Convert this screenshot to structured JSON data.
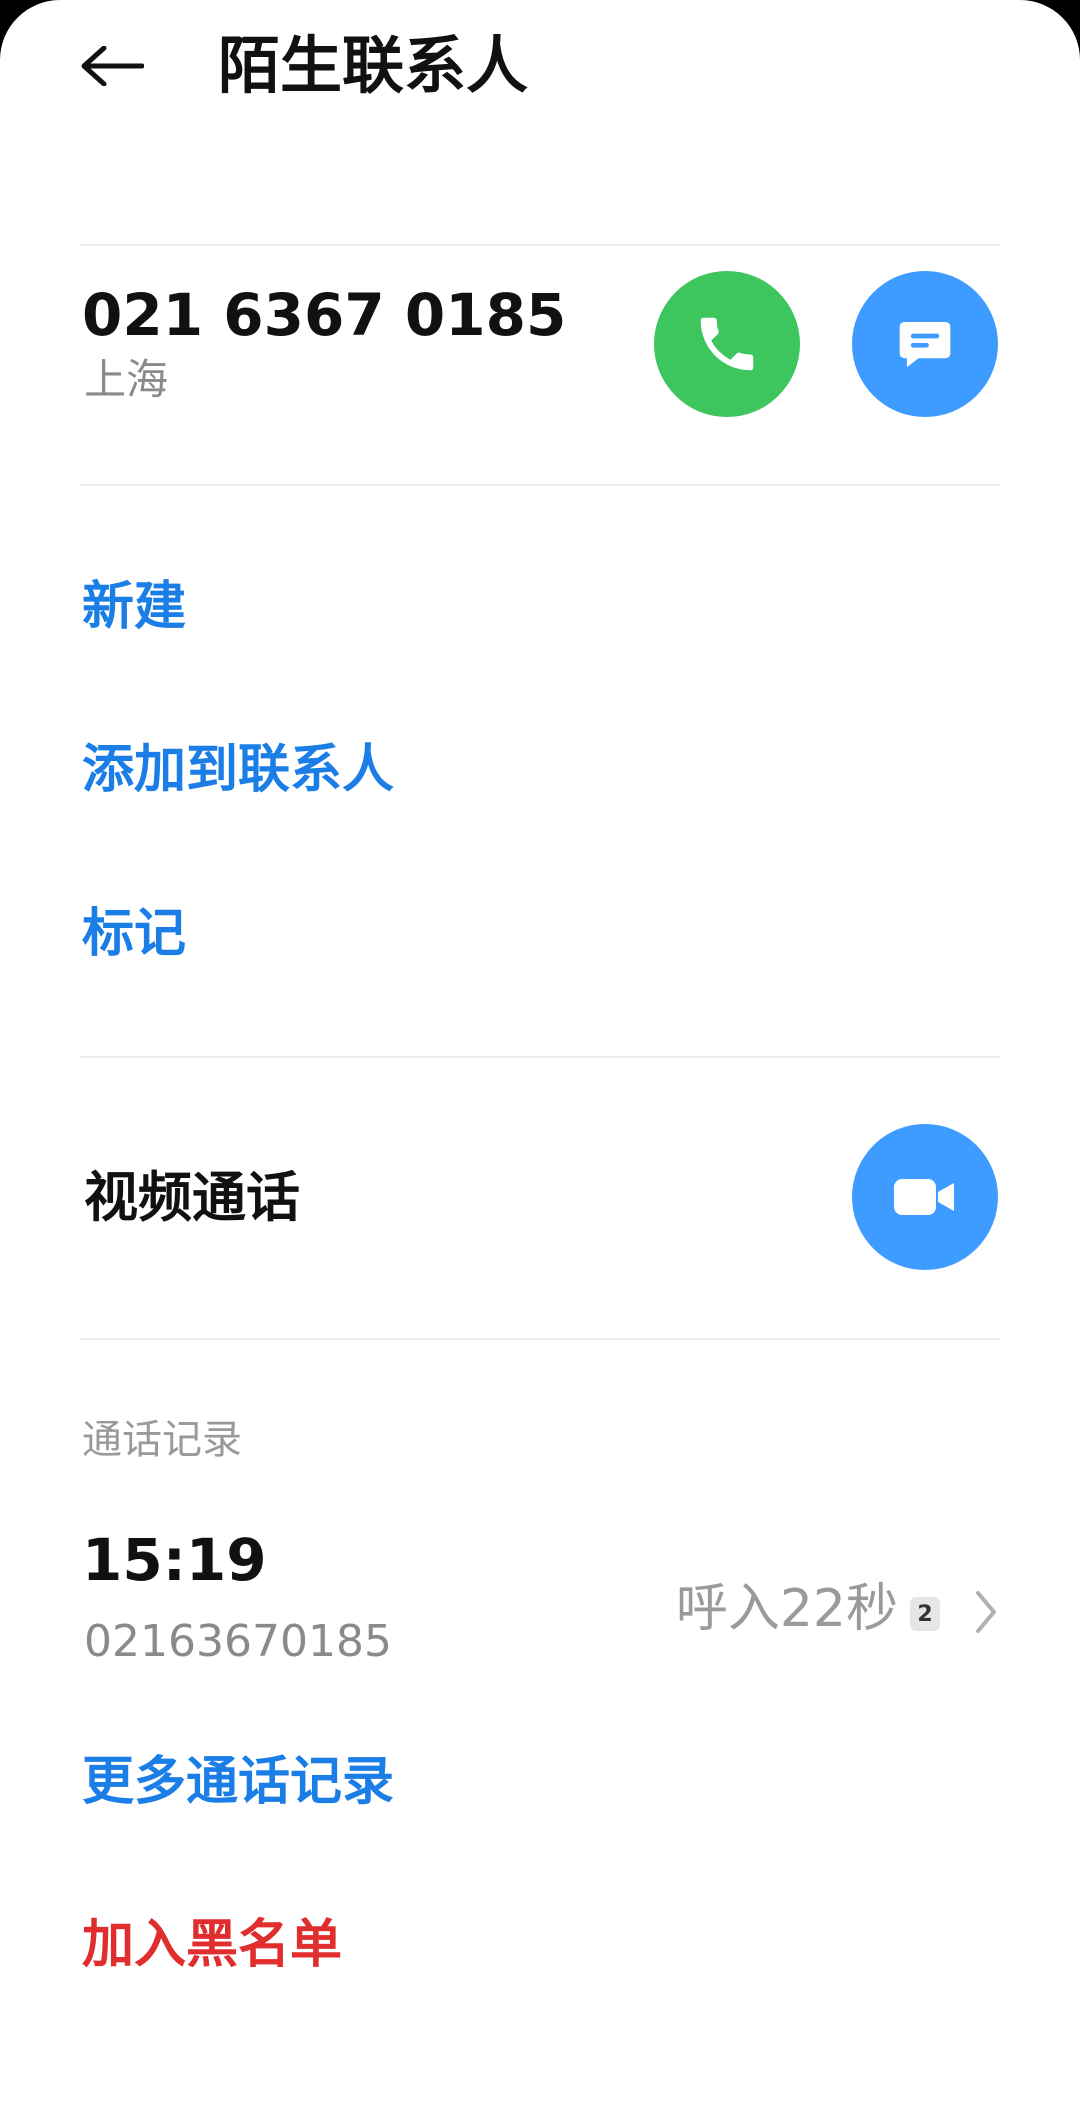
{
  "header": {
    "title": "陌生联系人",
    "back_icon": "arrow-left-icon"
  },
  "contact": {
    "phone_number": "021 6367 0185",
    "location": "上海",
    "call_icon": "phone-icon",
    "message_icon": "message-icon"
  },
  "actions": {
    "new_label": "新建",
    "add_to_contacts_label": "添加到联系人",
    "mark_label": "标记"
  },
  "video_call": {
    "label": "视频通话",
    "icon": "video-camera-icon"
  },
  "call_log": {
    "section_title": "通话记录",
    "entries": [
      {
        "time": "15:19",
        "number": "02163670185",
        "status": "呼入22秒",
        "sim_badge": "2"
      }
    ],
    "more_label": "更多通话记录"
  },
  "blacklist": {
    "label": "加入黑名单"
  },
  "colors": {
    "call_green": "#3dc55e",
    "accent_blue": "#3e9bff",
    "link_blue": "#1a7ee6",
    "danger_red": "#e02d2d"
  }
}
